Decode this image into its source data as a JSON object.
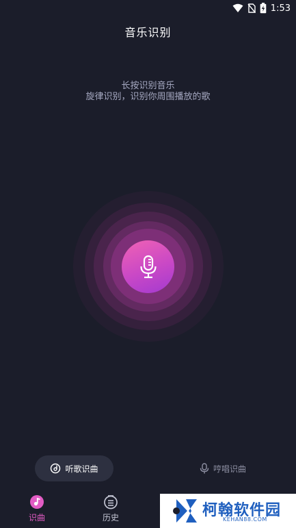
{
  "status_bar": {
    "time": "1:53"
  },
  "header": {
    "title": "音乐识别"
  },
  "hint": {
    "line1": "长按识别音乐",
    "line2": "旋律识别，识别你周围播放的歌"
  },
  "modes": {
    "listen_label": "听歌识曲",
    "hum_label": "哼唱识曲"
  },
  "bottom_nav": {
    "identify_label": "识曲",
    "history_label": "历史"
  },
  "watermark": {
    "text": "柯翰软件园",
    "sub": "KEHAN88.COM"
  },
  "colors": {
    "background": "#1b1d2a",
    "accent_pink": "#e25cc4",
    "mic_gradient_start": "#f062b4",
    "mic_gradient_end": "#a33ad0"
  }
}
